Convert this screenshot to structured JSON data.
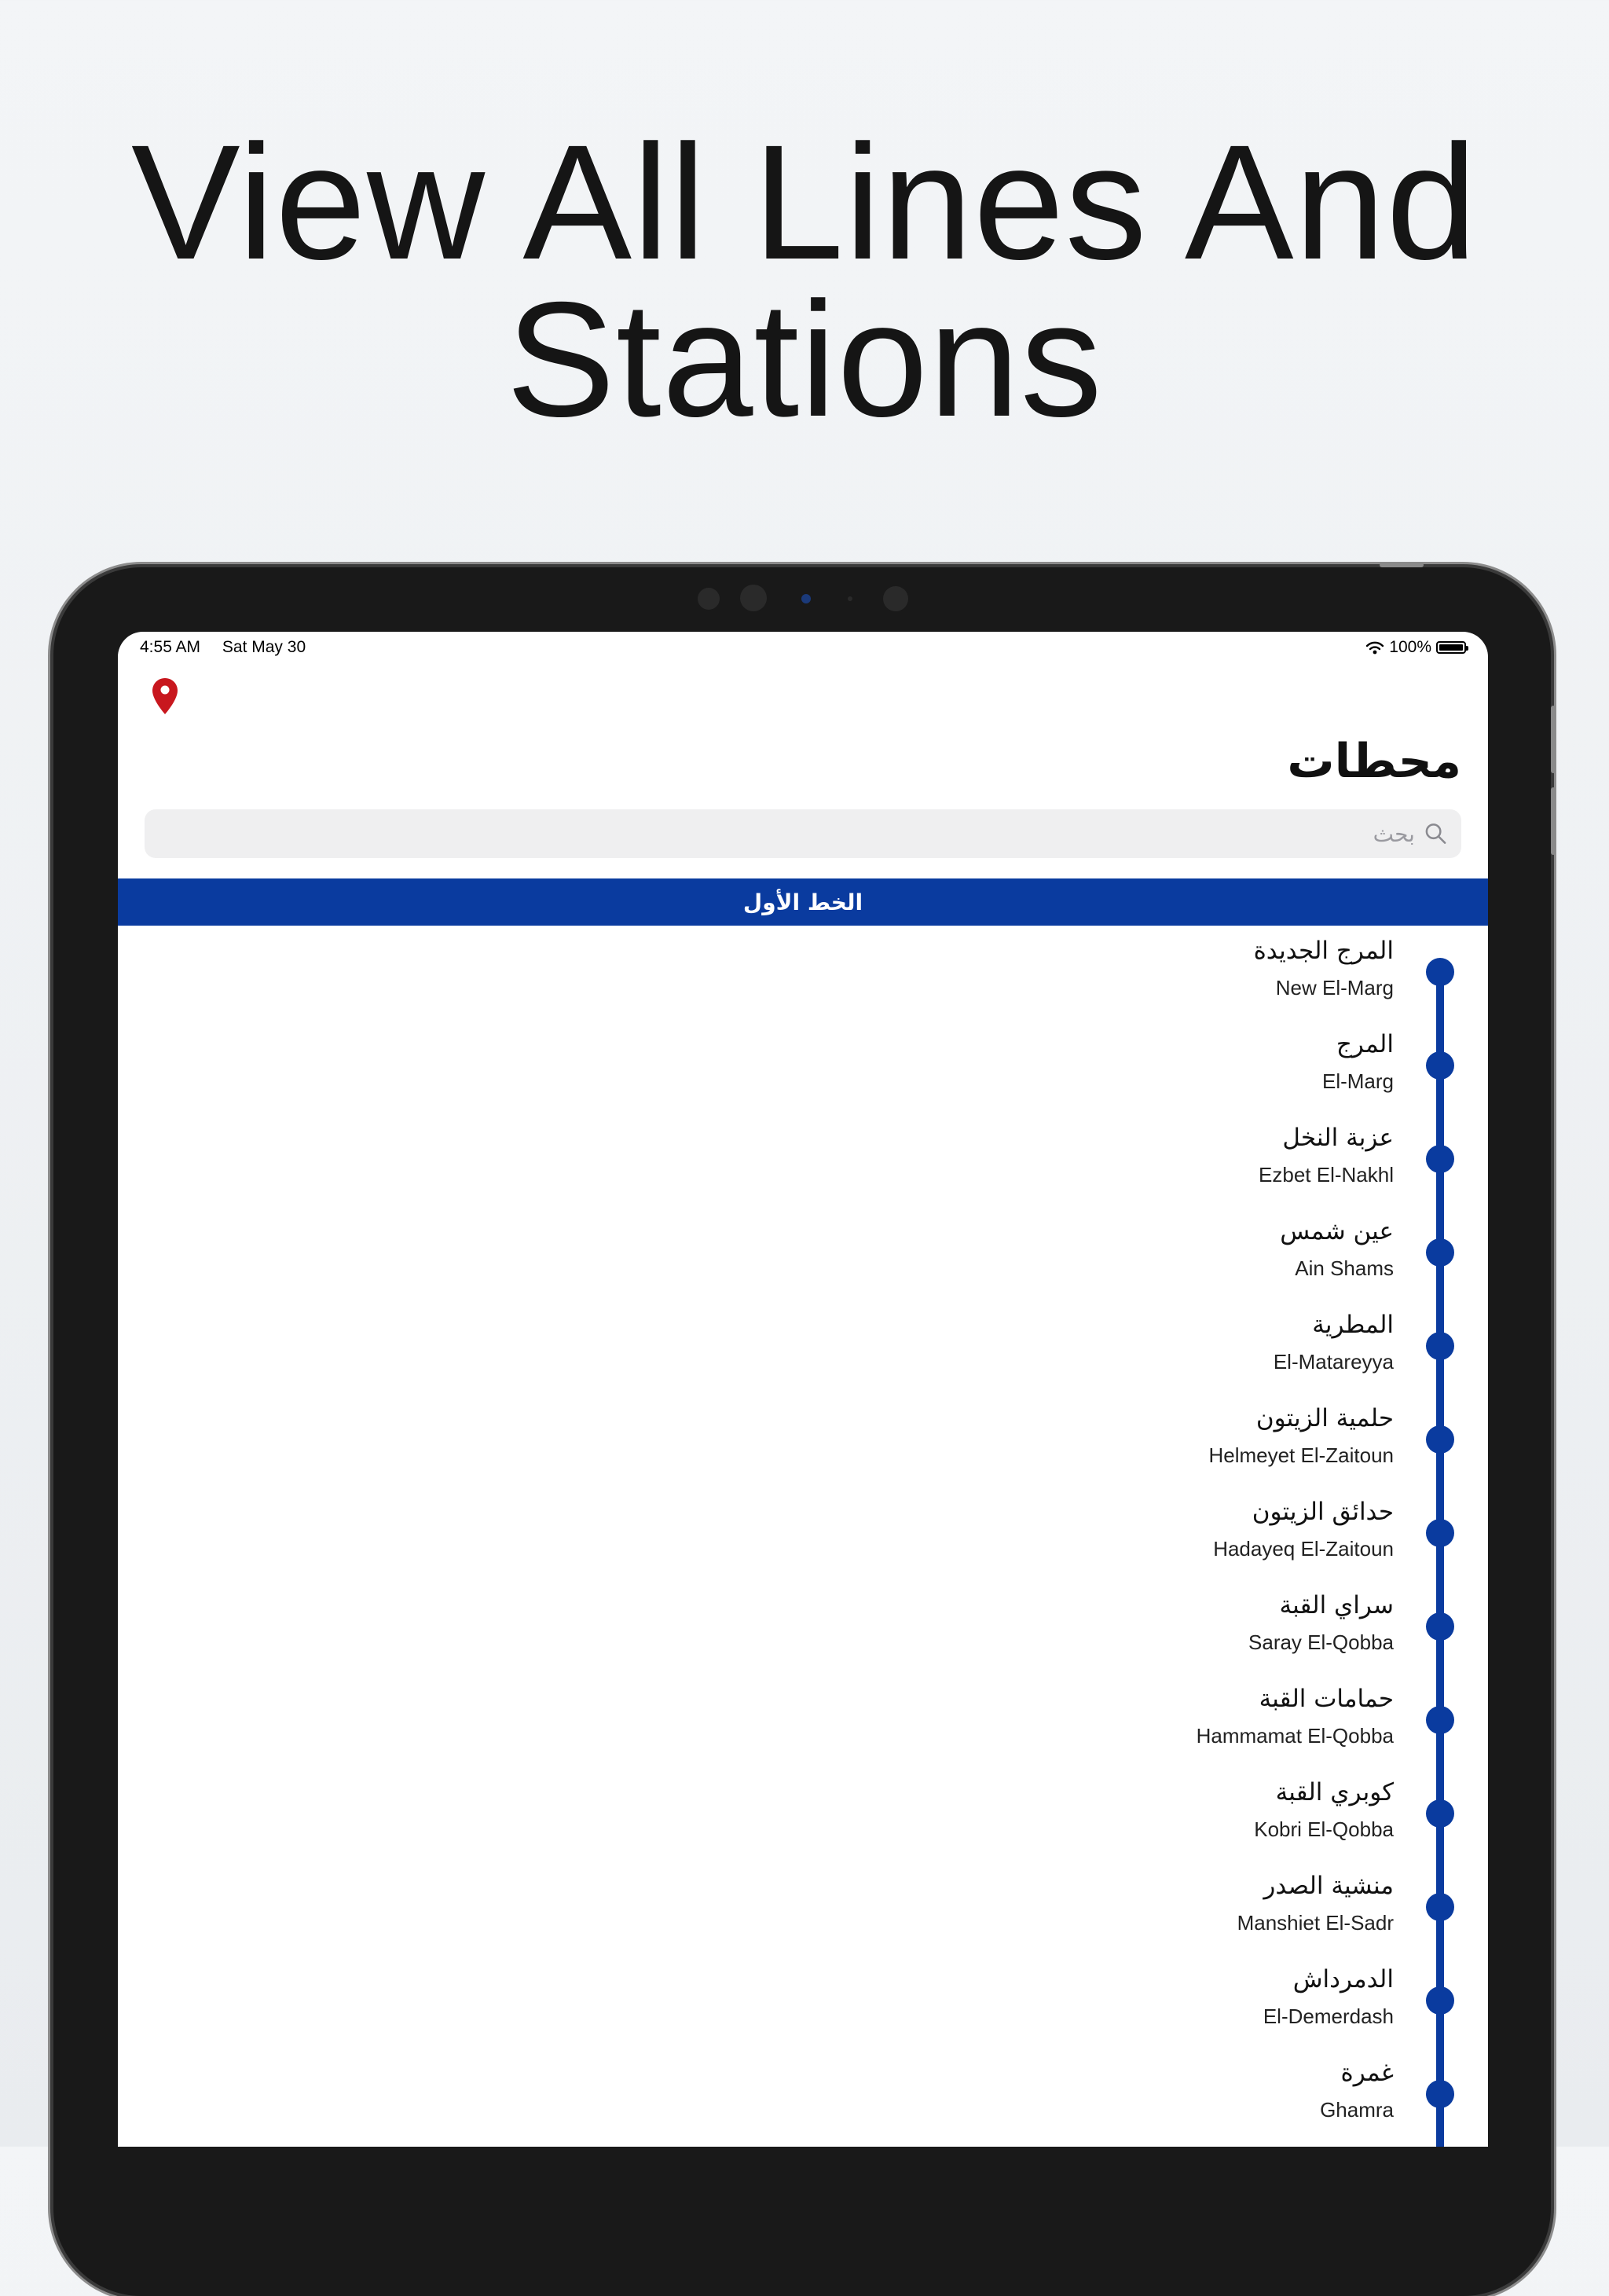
{
  "headline": [
    "View All Lines And",
    "Stations"
  ],
  "status": {
    "time": "4:55 AM",
    "date": "Sat May 30",
    "battery": "100%"
  },
  "icons": {
    "location": "location-pin-icon",
    "search": "search-icon",
    "wifi": "wifi-icon",
    "battery": "battery-icon"
  },
  "colors": {
    "accent": "#0a3b9f",
    "pin": "#c8171e"
  },
  "page": {
    "title": "محطات"
  },
  "search": {
    "placeholder": "بحث"
  },
  "line": {
    "name": "الخط الأول"
  },
  "stations": [
    {
      "ar": "المرج الجديدة",
      "en": "New El-Marg"
    },
    {
      "ar": "المرج",
      "en": "El-Marg"
    },
    {
      "ar": "عزبة النخل",
      "en": "Ezbet El-Nakhl"
    },
    {
      "ar": "عين شمس",
      "en": "Ain Shams"
    },
    {
      "ar": "المطرية",
      "en": "El-Matareyya"
    },
    {
      "ar": "حلمية الزيتون",
      "en": "Helmeyet El-Zaitoun"
    },
    {
      "ar": "حدائق الزيتون",
      "en": "Hadayeq El-Zaitoun"
    },
    {
      "ar": "سراي القبة",
      "en": "Saray El-Qobba"
    },
    {
      "ar": "حمامات القبة",
      "en": "Hammamat El-Qobba"
    },
    {
      "ar": "كوبري القبة",
      "en": "Kobri El-Qobba"
    },
    {
      "ar": "منشية الصدر",
      "en": "Manshiet El-Sadr"
    },
    {
      "ar": "الدمرداش",
      "en": "El-Demerdash"
    },
    {
      "ar": "غمرة",
      "en": "Ghamra"
    }
  ]
}
